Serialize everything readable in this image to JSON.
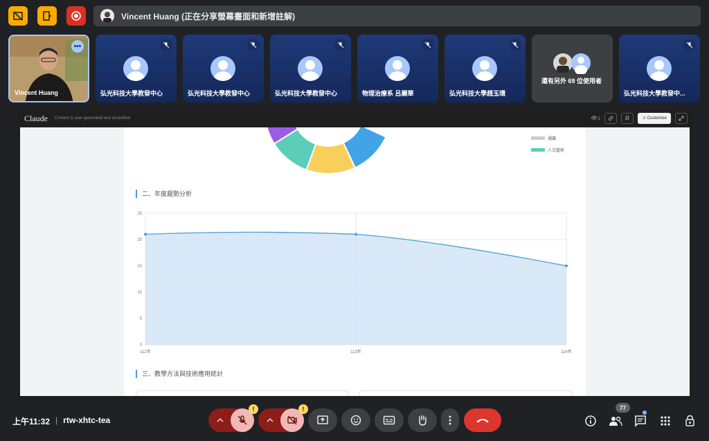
{
  "banner": {
    "text": "Vincent Huang (正在分享螢幕畫面和新增註解)"
  },
  "tiles": [
    {
      "label": "Vincent Huang"
    },
    {
      "label": "弘光科技大學教發中心"
    },
    {
      "label": "弘光科技大學教發中心"
    },
    {
      "label": "弘光科技大學教發中心"
    },
    {
      "label": "物理治療系 呂麗華"
    },
    {
      "label": "弘光科技大學趙玉環"
    },
    {
      "label": "還有另外 69 位使用者"
    },
    {
      "label": "弘光科技大學教發中..."
    }
  ],
  "artifact": {
    "app_name": "Claude",
    "note": "Content is user-generated and unverified.",
    "views": "2",
    "customize_label": "Customize",
    "legend": [
      {
        "label": "通識",
        "color": "#cccccc"
      },
      {
        "label": "人文藝術",
        "color": "#5bcdb9"
      }
    ],
    "section2_title": "二、年度趨勢分析",
    "section3_title": "三、教學方法與技術應用統計",
    "donut_colors": [
      "#9b5de5",
      "#5bcdb9",
      "#f7cf5b",
      "#41a4e6"
    ]
  },
  "chart_data": {
    "type": "area",
    "x": [
      "112年",
      "113年",
      "114年"
    ],
    "series": [
      {
        "values": [
          21,
          21,
          15
        ]
      }
    ],
    "ylim": [
      0,
      25
    ],
    "yticks": [
      0,
      5,
      10,
      15,
      20,
      25
    ],
    "grid": true,
    "color": "#4a9fd8"
  },
  "controls": {
    "time": "上午11:32",
    "meeting_code": "rtw-xhtc-tea",
    "people_count": "77"
  }
}
